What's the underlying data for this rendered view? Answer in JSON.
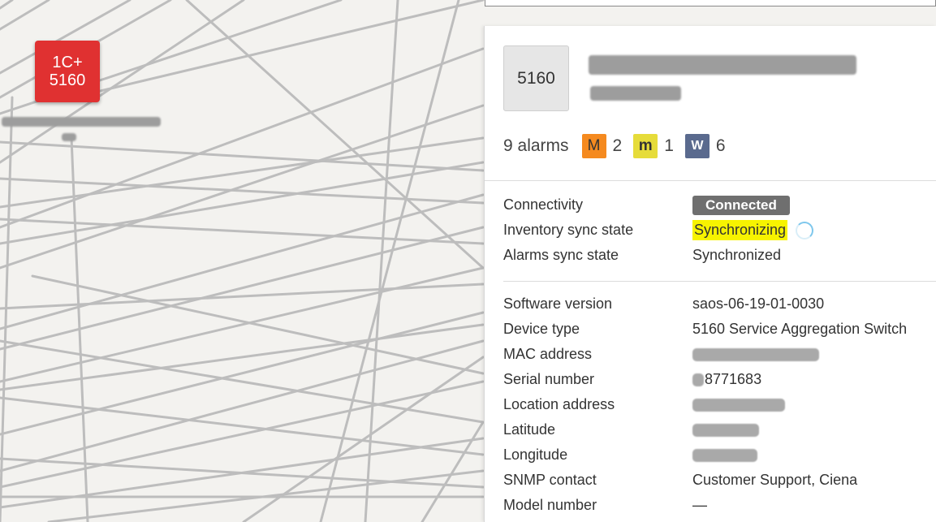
{
  "map": {
    "node": {
      "line1": "1C+",
      "line2": "5160"
    }
  },
  "panel": {
    "device_tile_label": "5160",
    "alarms": {
      "summary": "9 alarms",
      "major": {
        "letter": "M",
        "count": "2",
        "color": "#f58a1f"
      },
      "minor": {
        "letter": "m",
        "count": "1",
        "color": "#e6dc3a"
      },
      "warning": {
        "letter": "W",
        "count": "6",
        "color": "#5a6a8e"
      }
    },
    "status": {
      "connectivity_label": "Connectivity",
      "connectivity_value": "Connected",
      "inventory_label": "Inventory sync state",
      "inventory_value": "Synchronizing",
      "alarms_sync_label": "Alarms sync state",
      "alarms_sync_value": "Synchronized"
    },
    "properties": {
      "software_label": "Software version",
      "software_value": "saos-06-19-01-0030",
      "device_type_label": "Device type",
      "device_type_value": "5160 Service Aggregation Switch",
      "mac_label": "MAC address",
      "serial_label": "Serial number",
      "serial_value": "8771683",
      "location_label": "Location address",
      "latitude_label": "Latitude",
      "longitude_label": "Longitude",
      "snmp_label": "SNMP contact",
      "snmp_value": "Customer Support, Ciena",
      "model_label": "Model number",
      "model_value": "—"
    }
  },
  "colors": {
    "node_red": "#e03131",
    "highlight_yellow": "#f7f300",
    "connected_badge": "#6f6f6f"
  }
}
